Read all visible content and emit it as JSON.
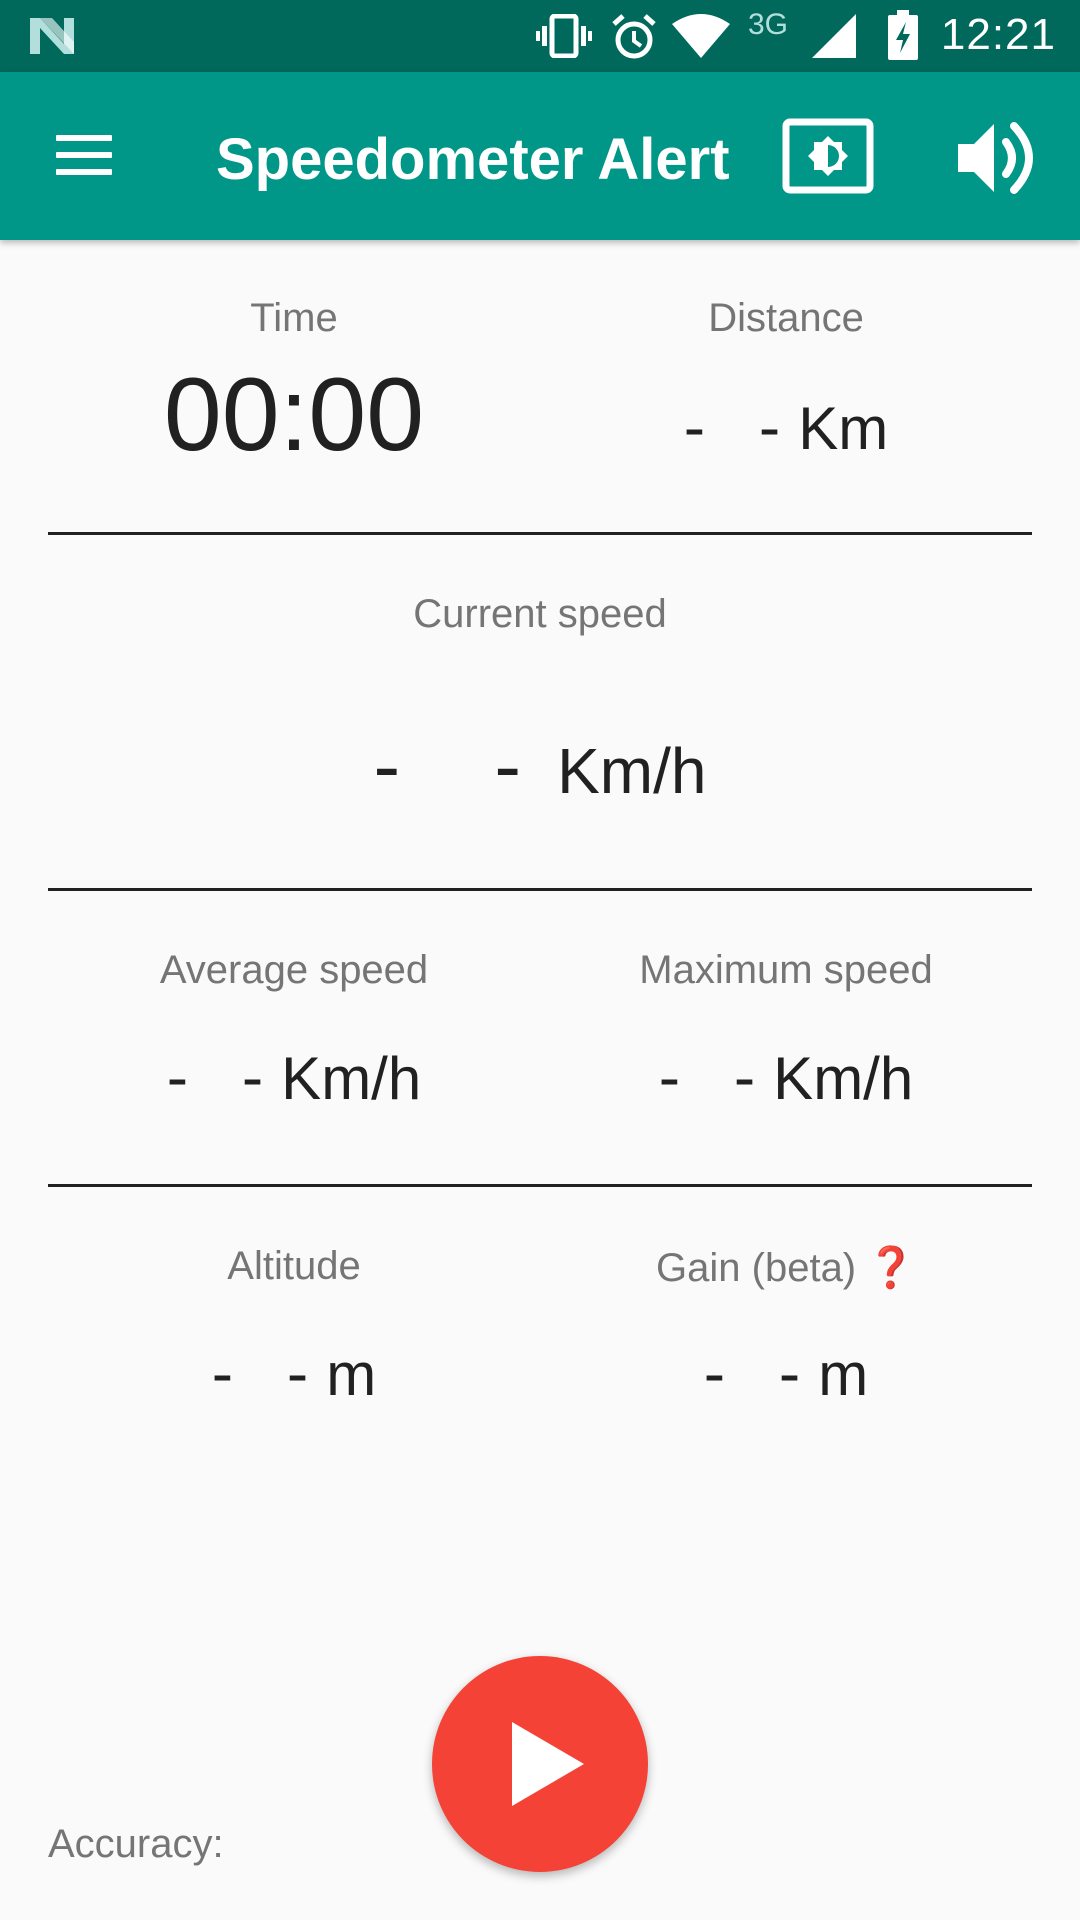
{
  "status_bar": {
    "time": "12:21",
    "network": "3G",
    "icons": [
      "notification-n-icon",
      "vibrate-icon",
      "alarm-icon",
      "wifi-icon",
      "cell-signal-icon",
      "battery-charging-icon"
    ]
  },
  "app_bar": {
    "title": "Speedometer Alert",
    "icons": [
      "menu-icon",
      "brightness-icon",
      "volume-icon"
    ],
    "color": "#009688"
  },
  "stats": {
    "time": {
      "label": "Time",
      "value": "00:00"
    },
    "distance": {
      "label": "Distance",
      "value": "- -",
      "unit": "Km"
    },
    "current_speed": {
      "label": "Current speed",
      "value": "- -",
      "unit": "Km/h"
    },
    "average_speed": {
      "label": "Average speed",
      "value": "- -",
      "unit": "Km/h"
    },
    "maximum_speed": {
      "label": "Maximum speed",
      "value": "- -",
      "unit": "Km/h"
    },
    "altitude": {
      "label": "Altitude",
      "value": "- -",
      "unit": "m"
    },
    "gain": {
      "label": "Gain (beta)",
      "help_icon": "❓",
      "value": "- -",
      "unit": "m"
    }
  },
  "footer": {
    "accuracy_label": "Accuracy:",
    "play_button_icon": "play-icon",
    "play_button_color": "#f44336"
  }
}
